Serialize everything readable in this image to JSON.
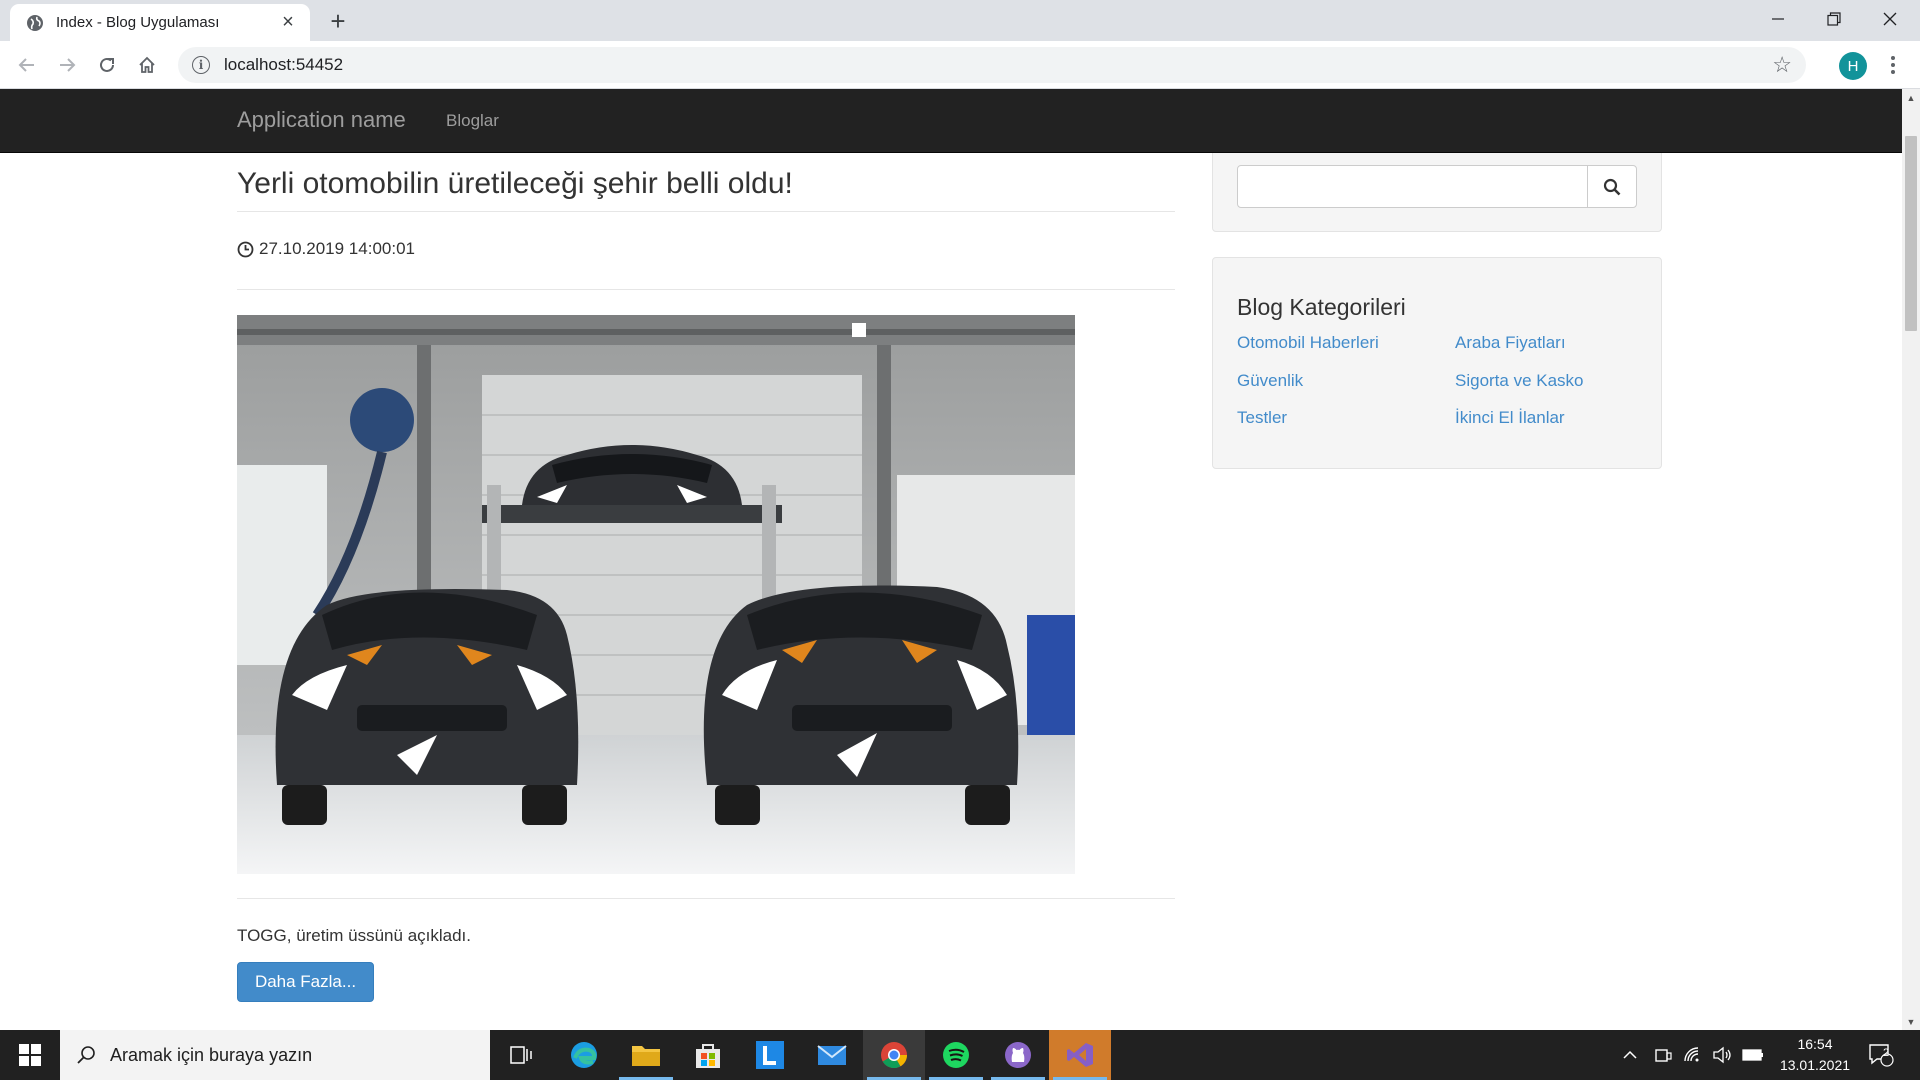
{
  "browser": {
    "tab_title": "Index - Blog Uygulaması",
    "url": "localhost:54452",
    "profile_initial": "H"
  },
  "navbar": {
    "brand": "Application name",
    "links": [
      "Bloglar"
    ]
  },
  "post": {
    "title": "Yerli otomobilin üretileceği şehir belli oldu!",
    "date": "27.10.2019 14:00:01",
    "excerpt": "TOGG, üretim üssünü açıkladı.",
    "more_label": "Daha Fazla...",
    "image_description_icon": "car-garage-image"
  },
  "sidebar": {
    "search_placeholder": "",
    "categories_title": "Blog Kategorileri",
    "categories": [
      "Otomobil Haberleri",
      "Araba Fiyatları",
      "Güvenlik",
      "Sigorta ve Kasko",
      "Testler",
      "İkinci El İlanlar"
    ]
  },
  "taskbar": {
    "search_placeholder": "Aramak için buraya yazın",
    "time": "16:54",
    "date": "13.01.2021",
    "notification_count": "2"
  },
  "colors": {
    "navbar_bg": "#222222",
    "link": "#428bca",
    "button": "#428bca",
    "well_bg": "#f5f5f5",
    "taskbar_bg": "#212121",
    "profile_bg": "#12939a"
  }
}
